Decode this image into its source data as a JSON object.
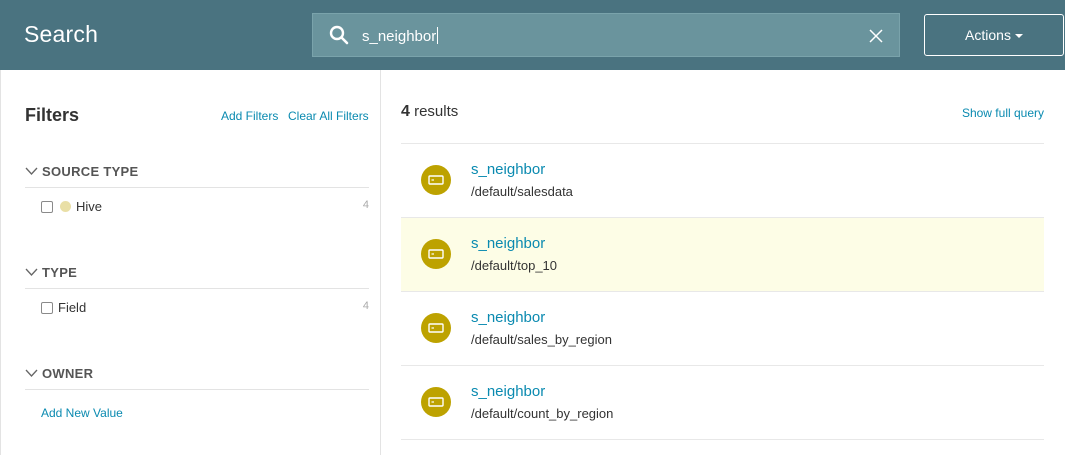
{
  "header": {
    "title": "Search",
    "search_value": "s_neighbor",
    "actions_label": "Actions"
  },
  "filters": {
    "title": "Filters",
    "add_filters": "Add Filters",
    "clear_all": "Clear All Filters",
    "sections": [
      {
        "label": "SOURCE TYPE",
        "items": [
          {
            "label": "Hive",
            "count": "4",
            "checked": false
          }
        ]
      },
      {
        "label": "TYPE",
        "items": [
          {
            "label": "Field",
            "count": "4",
            "checked": false
          }
        ]
      },
      {
        "label": "OWNER",
        "items": []
      }
    ],
    "add_new_value": "Add New Value"
  },
  "results": {
    "count": "4",
    "count_suffix": "results",
    "show_full_query": "Show full query",
    "items": [
      {
        "name": "s_neighbor",
        "path": "/default/salesdata"
      },
      {
        "name": "s_neighbor",
        "path": "/default/top_10"
      },
      {
        "name": "s_neighbor",
        "path": "/default/sales_by_region"
      },
      {
        "name": "s_neighbor",
        "path": "/default/count_by_region"
      }
    ],
    "highlighted_index": 1
  },
  "colors": {
    "header_bg": "#4a7380",
    "link": "#0a8ab0",
    "result_icon": "#bda200",
    "hive_dot": "#e9dfa6",
    "highlight_row": "#fdfde6"
  },
  "icons": {
    "search": "search-icon",
    "clear": "close-icon",
    "actions_caret": "caret-down-icon",
    "section_toggle": "chevron-down-icon",
    "result_type": "field-icon"
  }
}
